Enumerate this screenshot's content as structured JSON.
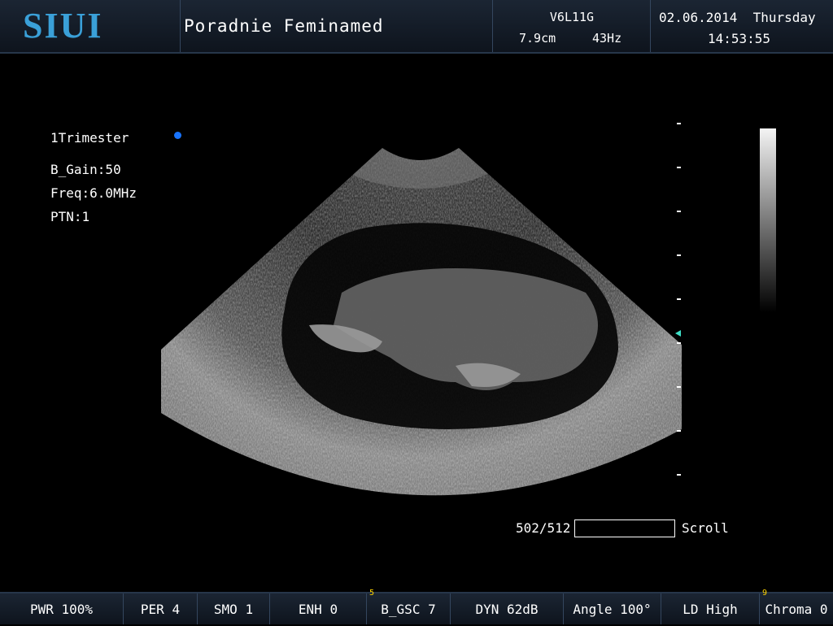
{
  "header": {
    "logo": "SIUI",
    "clinic": "Poradnie Feminamed",
    "probe": "V6L11G",
    "depth": "7.9cm",
    "frame_rate": "43Hz",
    "date_day": "02.06.2014  Thursday",
    "time": "14:53:55"
  },
  "info": {
    "preset": "1Trimester",
    "gain": "B_Gain:50",
    "freq": "Freq:6.0MHz",
    "ptn": "PTN:1"
  },
  "scroll": {
    "position": "502/512",
    "label": "Scroll"
  },
  "colors": {
    "logo": "#3aa0d8",
    "dot": "#1874ff",
    "focus_marker": "#3ee0c8",
    "knob_number": "#ffd400"
  },
  "bottom": {
    "pwr": "PWR 100%",
    "per": "PER 4",
    "smo": "SMO 1",
    "enh": "ENH 0",
    "gsc_knob": "5",
    "gsc": "B_GSC 7",
    "dyn": "DYN 62dB",
    "angle": "Angle 100°",
    "ld": "LD High",
    "chroma_knob": "9",
    "chroma": "Chroma 0"
  }
}
